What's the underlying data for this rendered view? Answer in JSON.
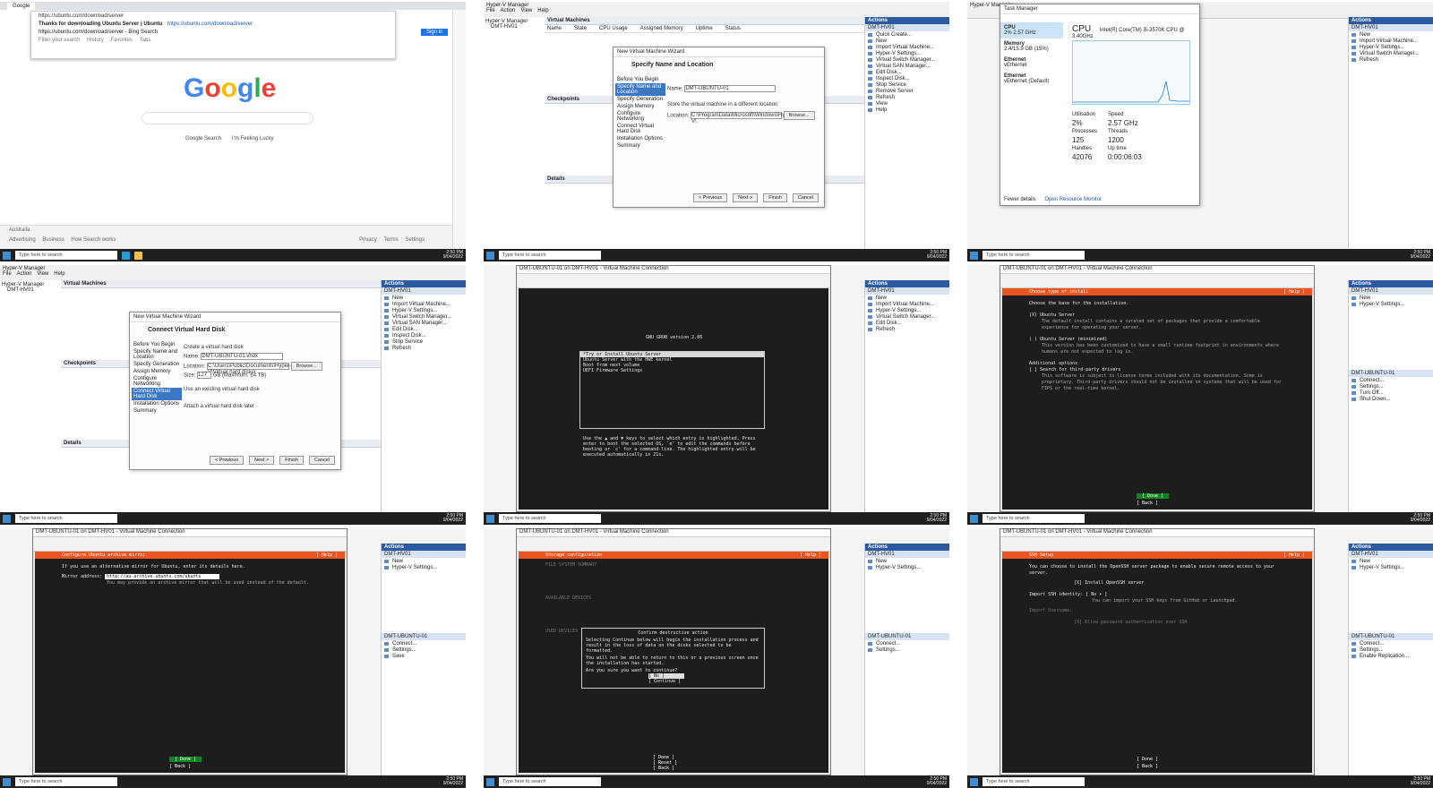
{
  "taskbar": {
    "search_placeholder": "Type here to search",
    "clock_time": "2:50 PM",
    "clock_date": "9/04/2022"
  },
  "tile1": {
    "tab_title": "Google",
    "address": "https://ubuntu.com/download/server",
    "suggestion_1_text": "Thanks for downloading Ubuntu Server | Ubuntu",
    "suggestion_1_url": "https://ubuntu.com/download/server",
    "suggestion_2": "https://ubuntu.com/download/server - Bing Search",
    "filter_label": "Filter your search",
    "filters": [
      "History",
      "Favorites",
      "Tabs"
    ],
    "sign_in": "Sign in",
    "logo": "Google",
    "buttons": [
      "Google Search",
      "I'm Feeling Lucky"
    ],
    "footer_country": "Australia",
    "footer_left": [
      "Advertising",
      "Business",
      "How Search works"
    ],
    "footer_right": [
      "Privacy",
      "Terms",
      "Settings"
    ]
  },
  "tile2": {
    "wizard_title": "New Virtual Machine Wizard",
    "heading": "Specify Name and Location",
    "steps": [
      "Before You Begin",
      "Specify Name and Location",
      "Specify Generation",
      "Assign Memory",
      "Configure Networking",
      "Connect Virtual Hard Disk",
      "Installation Options",
      "Summary"
    ],
    "name_label": "Name:",
    "name_value": "DMT-UBUNTU-01",
    "location_label": "Location:",
    "location_value": "C:\\ProgramData\\Microsoft\\Windows\\Hyper-V\\",
    "browse": "Browse...",
    "store_option": "Store the virtual machine in a different location",
    "buttons": [
      "< Previous",
      "Next >",
      "Finish",
      "Cancel"
    ]
  },
  "tile3": {
    "title": "Task Manager",
    "side": [
      "CPU",
      "Memory",
      "Ethernet",
      "Ethernet"
    ],
    "side_detail": [
      "2% 2.57 GHz",
      "2.4/15.9 GB (15%)",
      "vEthernet",
      "vEthernet (Default)"
    ],
    "cpu_label": "CPU",
    "cpu_model": "Intel(R) Core(TM) i5-3570K CPU @ 3.40GHz",
    "stats_labels": [
      "Utilisation",
      "Speed",
      "Processes",
      "Threads",
      "Handles",
      "Up time"
    ],
    "stats_values": [
      "2%",
      "2.57 GHz",
      "125",
      "1200",
      "42076",
      "0:00:06:03"
    ],
    "footer": [
      "Fewer details",
      "Open Resource Monitor"
    ]
  },
  "tile4": {
    "wizard_title": "New Virtual Machine Wizard",
    "heading": "Connect Virtual Hard Disk",
    "steps": [
      "Before You Begin",
      "Specify Name and Location",
      "Specify Generation",
      "Assign Memory",
      "Configure Networking",
      "Connect Virtual Hard Disk",
      "Installation Options",
      "Summary"
    ],
    "option_create": "Create a virtual hard disk",
    "name_label": "Name:",
    "name_value": "DMT-UBUNTU-01.vhdx",
    "location_label": "Location:",
    "location_value": "C:\\Users\\Public\\Documents\\Hyper-V\\Virtual hard disks\\",
    "size_label": "Size:",
    "size_value": "127",
    "size_unit": "GB (Maximum: 64 TB)",
    "option_existing": "Use an existing virtual hard disk",
    "option_later": "Attach a virtual hard disk later",
    "browse": "Browse...",
    "buttons": [
      "< Previous",
      "Next >",
      "Finish",
      "Cancel"
    ]
  },
  "tile5": {
    "window_title": "DMT-UBUNTU-01 on DMT-HV01 - Virtual Machine Connection",
    "grub_version": "GNU GRUB  version 2.06",
    "entries": [
      "*Try or Install Ubuntu Server",
      "Ubuntu Server with the HWE kernel",
      "Boot from next volume",
      "UEFI Firmware Settings"
    ],
    "help": "Use the ▲ and ▼ keys to select which entry is highlighted. Press enter to boot the selected OS, `e' to edit the commands before booting or `c' for a command-line. The highlighted entry will be executed automatically in 21s."
  },
  "tile6": {
    "bar_title": "Choose type of install",
    "help": "[ Help ]",
    "intro": "Choose the base for the installation.",
    "opt1": "(X)  Ubuntu Server",
    "opt1_desc": "The default install contains a curated set of packages that provide a comfortable experience for operating your server.",
    "opt2": "( )  Ubuntu Server (minimized)",
    "opt2_desc": "This version has been customized to have a small runtime footprint in environments where humans are not expected to log in.",
    "additional": "Additional options",
    "opt3": "[ ]  Search for third-party drivers",
    "opt3_desc": "This software is subject to license terms included with its documentation. Some is proprietary. Third-party drivers should not be installed on systems that will be used for FIPS or the real-time kernel.",
    "done": "[ Done ]",
    "back": "[ Back ]"
  },
  "tile7": {
    "bar_title": "Configure Ubuntu archive mirror",
    "help": "[ Help ]",
    "intro": "If you use an alternative mirror for Ubuntu, enter its details here.",
    "label": "Mirror address:",
    "value": "http://au.archive.ubuntu.com/ubuntu",
    "hint": "You may provide an archive mirror that will be used instead of the default.",
    "done": "[ Done ]",
    "back": "[ Back ]"
  },
  "tile8": {
    "bar_title": "Storage configuration",
    "help": "[ Help ]",
    "summary": "FILE SYSTEM SUMMARY",
    "available": "AVAILABLE DEVICES",
    "used": "USED DEVICES",
    "dlg_title": "Confirm destructive action",
    "dlg_text_1": "Selecting Continue below will begin the installation process and result in the loss of data on the disks selected to be formatted.",
    "dlg_text_2": "You will not be able to return to this or a previous screen once the installation has started.",
    "dlg_question": "Are you sure you want to continue?",
    "dlg_no": "[ No        ]",
    "dlg_yes": "[ Continue  ]",
    "done": "[ Done  ]",
    "reset": "[ Reset ]",
    "back": "[ Back  ]"
  },
  "tile9": {
    "bar_title": "SSH Setup",
    "help": "[ Help ]",
    "intro": "You can choose to install the OpenSSH server package to enable secure remote access to your server.",
    "install": "[X]  Install OpenSSH server",
    "import_label": "Import SSH identity:",
    "import_value": "[ No        ▾ ]",
    "import_hint": "You can import your SSH keys from GitHub or Launchpad.",
    "username_label": "Import Username:",
    "allow": "[X]  Allow password authentication over SSH",
    "done": "[ Done ]",
    "back": "[ Back ]"
  },
  "hyperv": {
    "app_title": "Hyper-V Manager",
    "menu": [
      "File",
      "Action",
      "View",
      "Help"
    ],
    "tree": [
      "Hyper-V Manager",
      "DMT-HV01"
    ],
    "vm_title": "Virtual Machines",
    "columns": [
      "Name",
      "State",
      "CPU Usage",
      "Assigned Memory",
      "Uptime",
      "Status",
      "Configuration Version"
    ],
    "checkpoints": "Checkpoints",
    "details": "Details",
    "actions_title": "Actions",
    "host": "DMT-HV01",
    "actions": [
      "Quick Create...",
      "New",
      "Import Virtual Machine...",
      "Hyper-V Settings...",
      "Virtual Switch Manager...",
      "Virtual SAN Manager...",
      "Edit Disk...",
      "Inspect Disk...",
      "Stop Service",
      "Remove Server",
      "Refresh",
      "View",
      "Help"
    ],
    "vm_actions_title": "DMT-UBUNTU-01",
    "vm_actions": [
      "Connect...",
      "Settings...",
      "Turn Off...",
      "Shut Down...",
      "Save",
      "Pause",
      "Reset",
      "Checkpoint",
      "Move...",
      "Export...",
      "Rename...",
      "Enable Replication...",
      "Help"
    ]
  },
  "colors": {
    "ubuntu_orange": "#e95420",
    "console_bg": "#1d1d1d",
    "hv_blue": "#2c5aa0",
    "done_green": "#0e8420"
  }
}
